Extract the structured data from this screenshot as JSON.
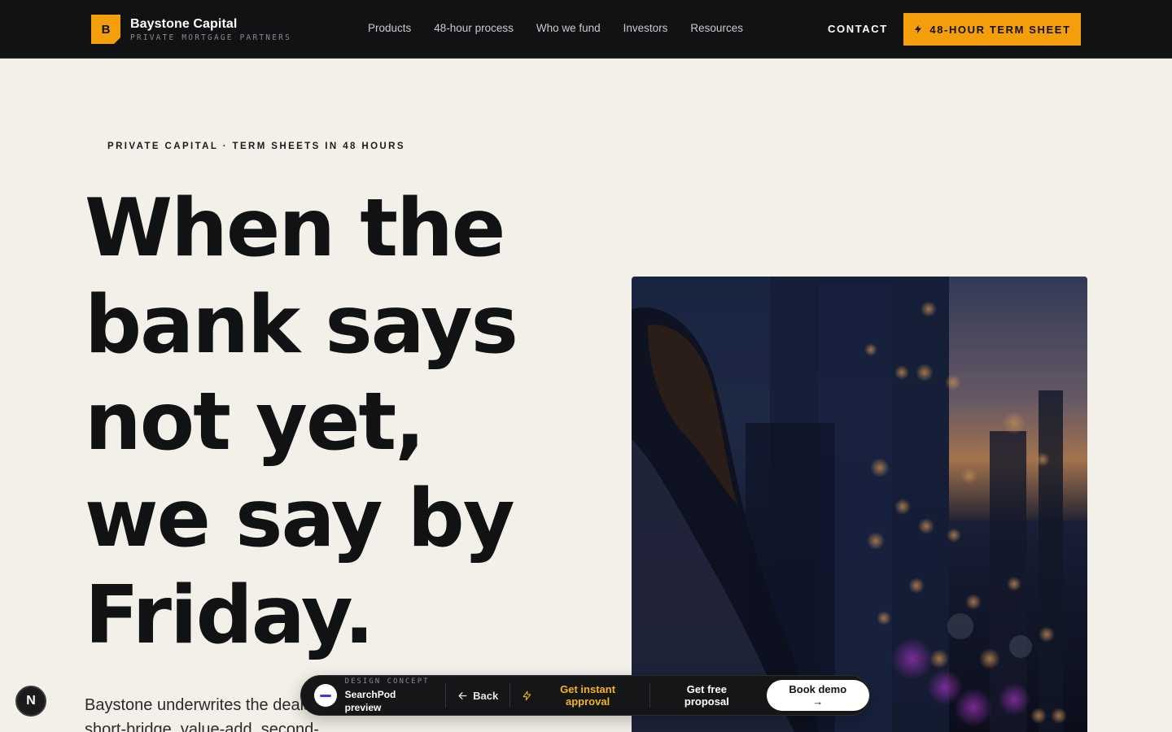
{
  "brand": {
    "mark": "B",
    "name": "Baystone Capital",
    "tagline": "PRIVATE MORTGAGE PARTNERS",
    "accent": "#f59e0b"
  },
  "nav": {
    "items": [
      {
        "label": "Products"
      },
      {
        "label": "48-hour process"
      },
      {
        "label": "Who we fund"
      },
      {
        "label": "Investors"
      },
      {
        "label": "Resources"
      }
    ],
    "contact_label": "CONTACT",
    "cta_label": "48-HOUR TERM SHEET",
    "cta_icon": "lightning-icon"
  },
  "hero": {
    "eyebrow": "PRIVATE CAPITAL · TERM SHEETS IN 48 HOURS",
    "headline_lines": [
      "When the",
      "bank says",
      "not yet,",
      "we say by",
      "Friday."
    ],
    "lede": "Baystone underwrites the deals inside its risk window — short-bridge, value-add, second-",
    "image_alt": "woman-overlooking-city-at-dusk"
  },
  "preview_bar": {
    "label": "DESIGN CONCEPT",
    "title": "SearchPod preview",
    "back_label": "Back",
    "approval_label": "Get instant approval",
    "proposal_label": "Get free proposal",
    "demo_label": "Book demo →",
    "approval_color": "#f5b320"
  },
  "dev_badge": {
    "label": "N"
  }
}
